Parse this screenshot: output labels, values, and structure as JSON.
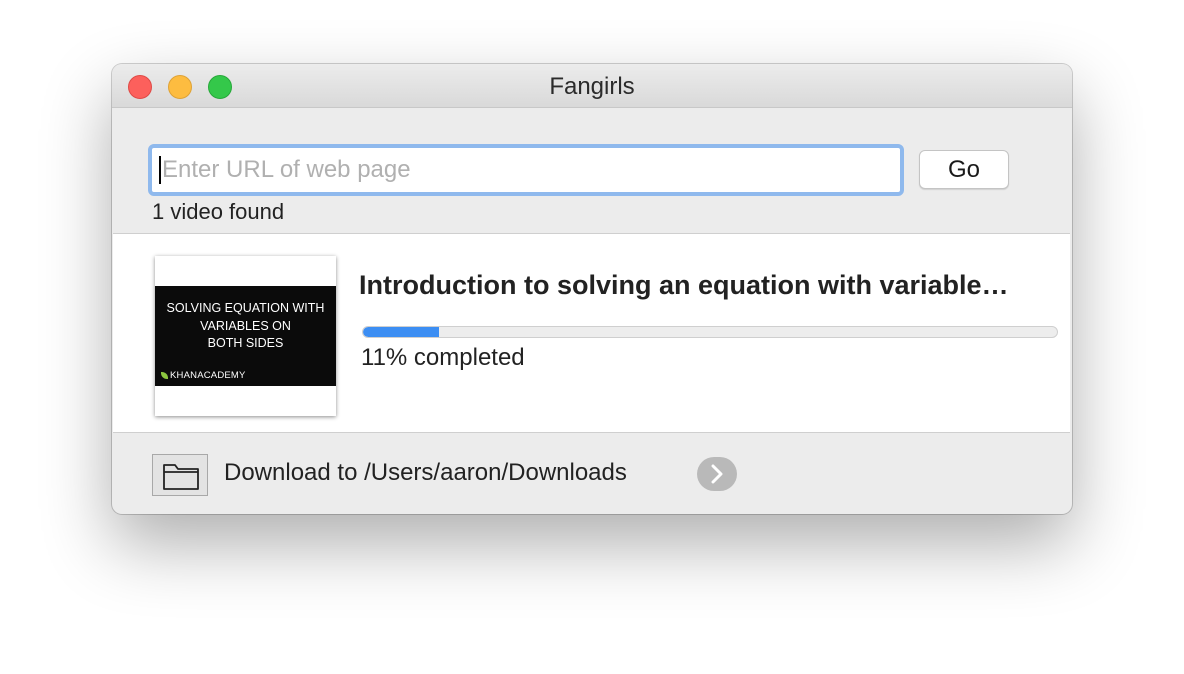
{
  "window": {
    "title": "Fangirls"
  },
  "search": {
    "value": "",
    "placeholder": "Enter URL of web page",
    "go_label": "Go"
  },
  "results": {
    "count_label": "1 video found"
  },
  "videos": [
    {
      "title": "Introduction to solving an equation with variable…",
      "thumbnail": {
        "caption_lines": [
          "SOLVING EQUATION WITH",
          "VARIABLES ON",
          "BOTH SIDES"
        ],
        "brand": "KHANACADEMY"
      },
      "progress_percent": 11,
      "progress_label": "11% completed",
      "progress_color": "#3c8ef3"
    }
  ],
  "footer": {
    "download_label": "Download to /Users/aaron/Downloads",
    "folder_icon": "folder-icon",
    "reveal_icon": "chevron-right-icon"
  },
  "colors": {
    "close": "#fc605c",
    "minimize": "#fdbc40",
    "maximize": "#34c84a",
    "focus_ring": "#8fb9ed"
  }
}
